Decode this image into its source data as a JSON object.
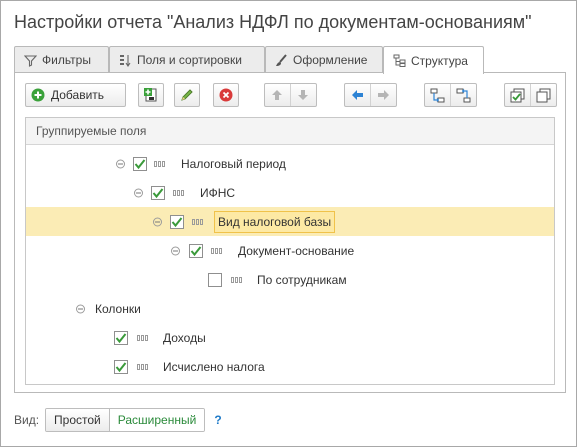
{
  "title": "Настройки отчета \"Анализ НДФЛ по документам-основаниям\"",
  "tabs": [
    {
      "label": "Фильтры",
      "icon": "filter-icon"
    },
    {
      "label": "Поля и сортировки",
      "icon": "sort-fields-icon"
    },
    {
      "label": "Оформление",
      "icon": "brush-icon"
    },
    {
      "label": "Структура",
      "icon": "structure-icon",
      "active": true
    }
  ],
  "toolbar": {
    "add_label": "Добавить"
  },
  "grid": {
    "header": "Группируемые поля",
    "rows": [
      {
        "label": "Налоговый период",
        "checked": true,
        "has_toggle": true
      },
      {
        "label": "ИФНС",
        "checked": true,
        "has_toggle": true
      },
      {
        "label": "Вид налоговой базы",
        "checked": true,
        "has_toggle": true,
        "selected": true
      },
      {
        "label": "Документ-основание",
        "checked": true,
        "has_toggle": true
      },
      {
        "label": "По сотрудникам",
        "checked": false,
        "has_toggle": false
      },
      {
        "label": "Колонки",
        "checked": null,
        "has_toggle": true
      },
      {
        "label": "Доходы",
        "checked": true,
        "has_toggle": false
      },
      {
        "label": "Исчислено налога",
        "checked": true,
        "has_toggle": false
      }
    ]
  },
  "footer": {
    "label": "Вид:",
    "simple": "Простой",
    "extended": "Расширенный",
    "help": "?"
  },
  "colors": {
    "check": "#3a9a3a",
    "selection": "#fbecb5",
    "add_green": "#3aa13a",
    "delete_red": "#d93a3a",
    "arrow_blue": "#2d83d4"
  }
}
